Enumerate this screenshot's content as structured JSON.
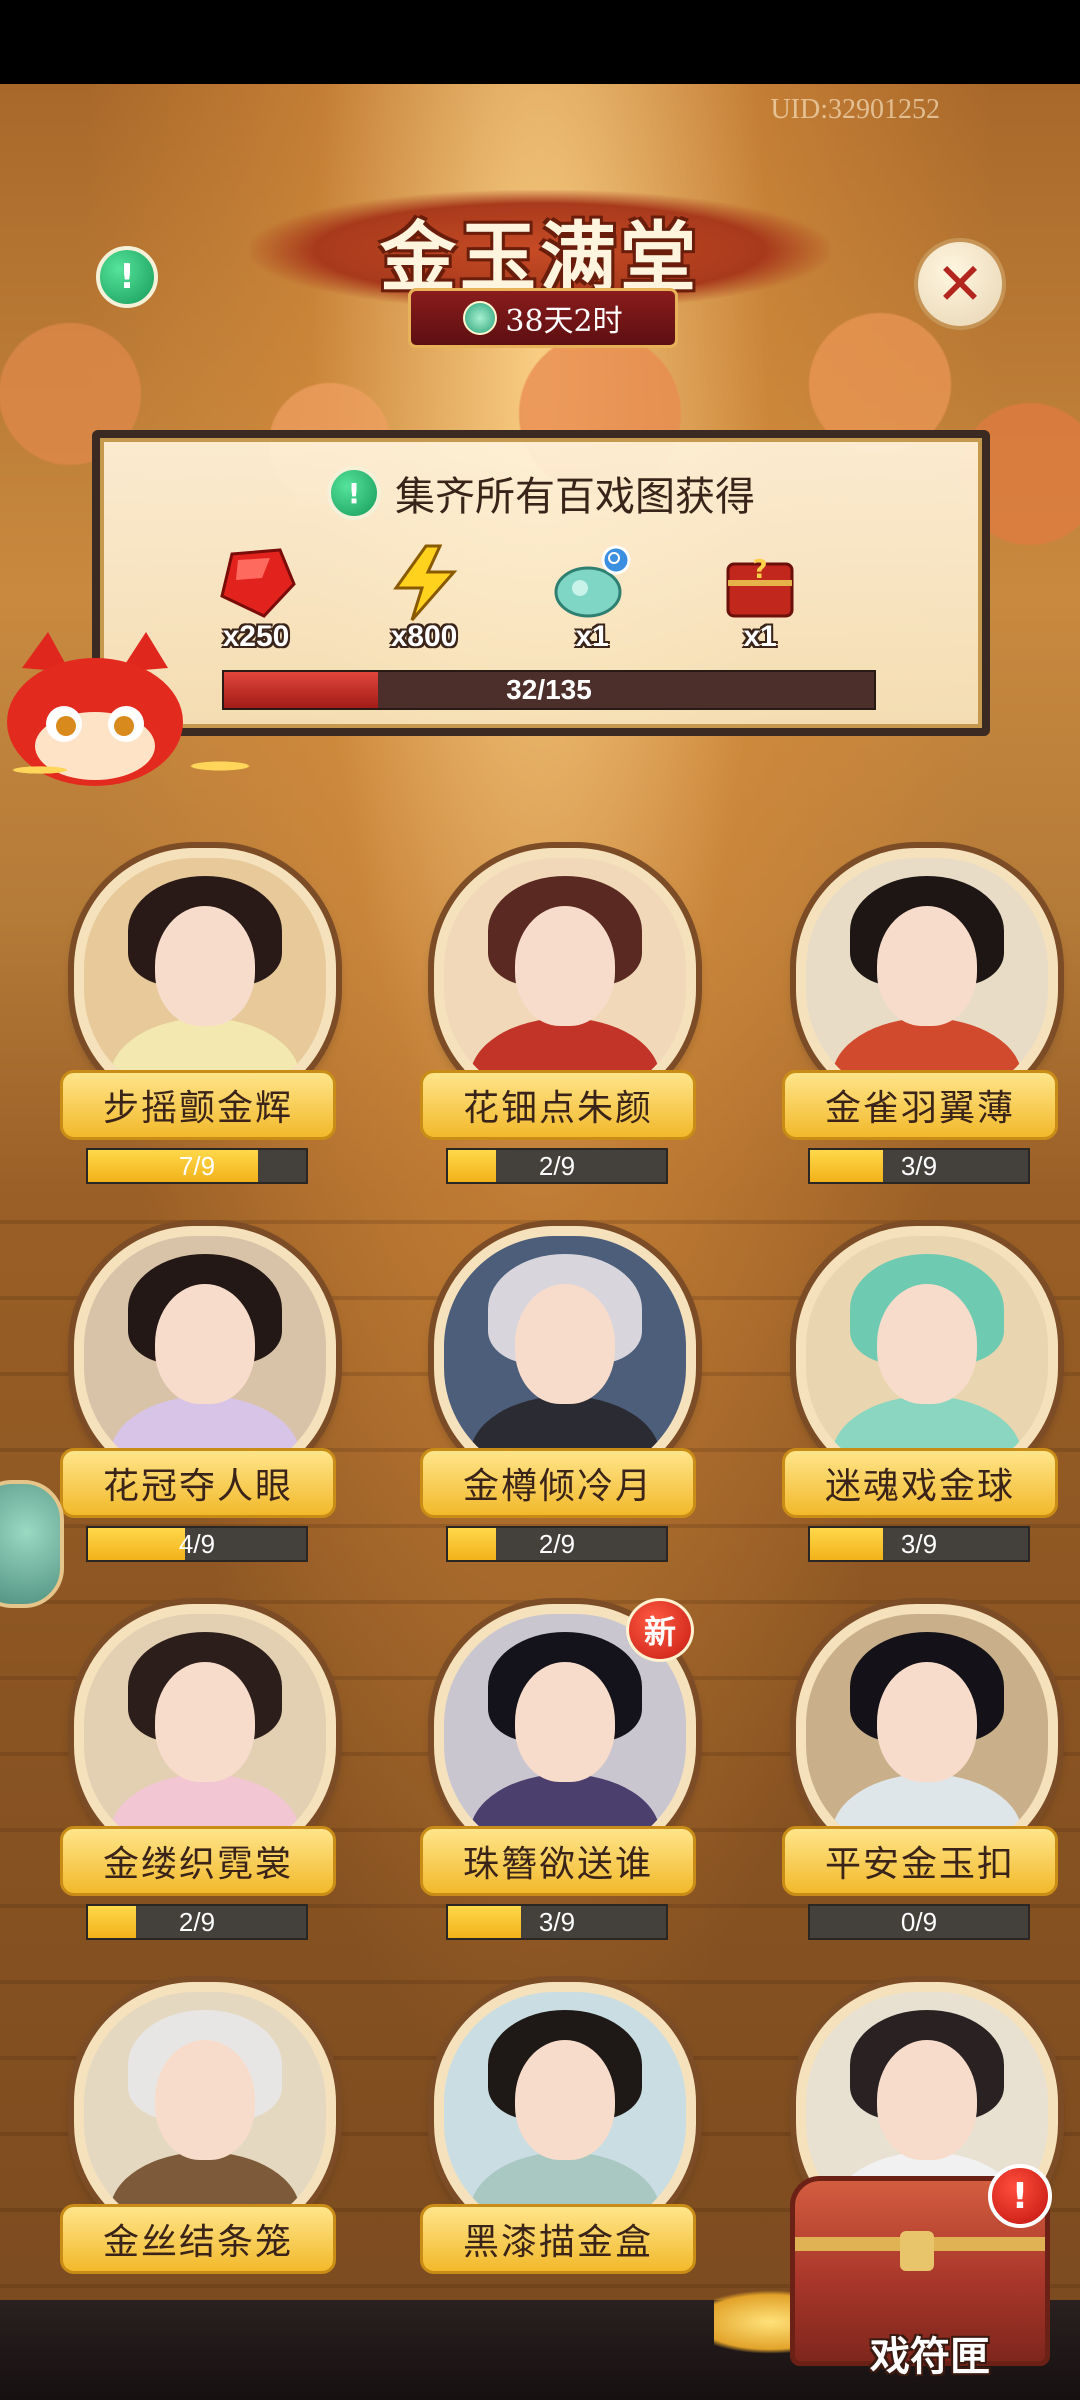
{
  "header": {
    "uid": "UID:32901252",
    "title": "金玉满堂",
    "timer": "38天2时"
  },
  "reward_panel": {
    "title": "集齐所有百戏图获得",
    "rewards": [
      {
        "icon": "ruby-gem-icon",
        "qty": "x250"
      },
      {
        "icon": "lightning-icon",
        "qty": "x800"
      },
      {
        "icon": "jade-pet-icon",
        "qty": "x1"
      },
      {
        "icon": "mystery-chest-icon",
        "qty": "x1"
      }
    ],
    "progress": {
      "text": "32/135",
      "value": 32,
      "max": 135
    }
  },
  "cards": [
    {
      "name": "步摇颤金辉",
      "progress": "7/9",
      "value": 7,
      "hair": "#2a1a17",
      "robe": "#f3e9b0",
      "bg": "#e7c99a"
    },
    {
      "name": "花钿点朱颜",
      "progress": "2/9",
      "value": 2,
      "hair": "#5a2a22",
      "robe": "#c23328",
      "bg": "#f0d8b8"
    },
    {
      "name": "金雀羽翼薄",
      "progress": "3/9",
      "value": 3,
      "hair": "#1e1614",
      "robe": "#d24a2e",
      "bg": "#e9dcc6"
    },
    {
      "name": "花冠夺人眼",
      "progress": "4/9",
      "value": 4,
      "hair": "#231815",
      "robe": "#d7c4e6",
      "bg": "#d9c3a8"
    },
    {
      "name": "金樽倾冷月",
      "progress": "2/9",
      "value": 2,
      "hair": "#d8d6dc",
      "robe": "#2b2b33",
      "bg": "#4d5e7a"
    },
    {
      "name": "迷魂戏金球",
      "progress": "3/9",
      "value": 3,
      "hair": "#6fcab2",
      "robe": "#8ad6c0",
      "bg": "#e9d6b0"
    },
    {
      "name": "金缕织霓裳",
      "progress": "2/9",
      "value": 2,
      "hair": "#2c1e1a",
      "robe": "#f2c6d2",
      "bg": "#e3cfb1"
    },
    {
      "name": "珠簪欲送谁",
      "progress": "3/9",
      "value": 3,
      "hair": "#14121a",
      "robe": "#4b3f6e",
      "bg": "#c9c6cf",
      "badge": "新"
    },
    {
      "name": "平安金玉扣",
      "progress": "0/9",
      "value": 0,
      "hair": "#141218",
      "robe": "#dfe6ea",
      "bg": "#c9b08a"
    },
    {
      "name": "金丝结条笼",
      "progress": "",
      "value": 0,
      "hair": "#e8e6e4",
      "robe": "#7d5a3a",
      "bg": "#e4d8c0"
    },
    {
      "name": "黑漆描金盒",
      "progress": "",
      "value": 0,
      "hair": "#1e1816",
      "robe": "#a9c8c2",
      "bg": "#c9dde2"
    },
    {
      "name": "",
      "progress": "",
      "value": 0,
      "hair": "#2a2222",
      "robe": "#f1f1f1",
      "bg": "#e8e0d0"
    }
  ],
  "chest": {
    "label": "戏符匣",
    "alert": "!"
  },
  "icons": {
    "info": "!",
    "close": "✕"
  },
  "colors": {
    "accent_gold": "#f2b92b",
    "card_bar": "#ffd84a",
    "main_bar": "#e0463c"
  }
}
